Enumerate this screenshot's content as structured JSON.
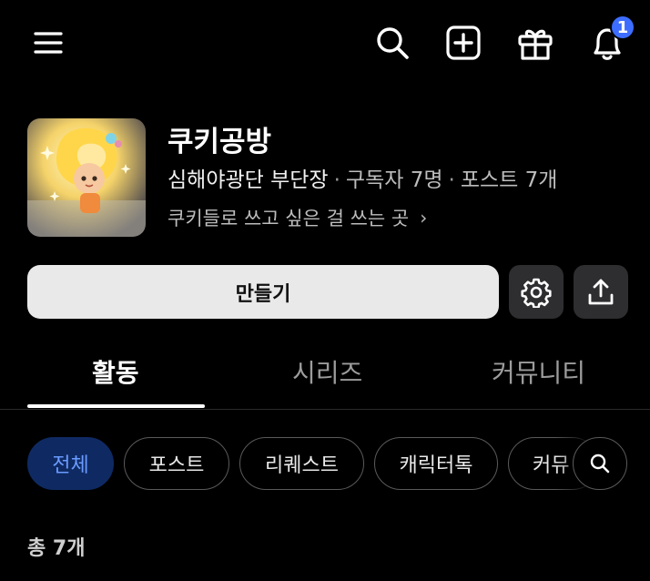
{
  "header": {
    "notification_count": "1",
    "icons": [
      "menu-icon",
      "search-icon",
      "add-post-icon",
      "gift-icon",
      "bell-icon"
    ]
  },
  "profile": {
    "name": "쿠키공방",
    "owner": "심해야광단 부단장",
    "subscribers": "구독자 7명",
    "posts": "포스트 7개",
    "separator": "·",
    "description": "쿠키들로 쓰고 싶은 걸 쓰는 곳",
    "description_chevron": "›"
  },
  "actions": {
    "create_label": "만들기"
  },
  "tabs": [
    {
      "label": "활동",
      "active": true
    },
    {
      "label": "시리즈",
      "active": false
    },
    {
      "label": "커뮤니티",
      "active": false
    }
  ],
  "chips": [
    {
      "label": "전체",
      "active": true
    },
    {
      "label": "포스트",
      "active": false
    },
    {
      "label": "리퀘스트",
      "active": false
    },
    {
      "label": "캐릭터톡",
      "active": false
    },
    {
      "label": "커뮤",
      "active": false
    }
  ],
  "list": {
    "total_label": "총 7개"
  },
  "colors": {
    "background": "#000000",
    "badge": "#3d6dff",
    "active_chip_bg": "#0f2a63",
    "active_chip_text": "#6a9bff",
    "create_button_bg": "#e9e9e9"
  }
}
